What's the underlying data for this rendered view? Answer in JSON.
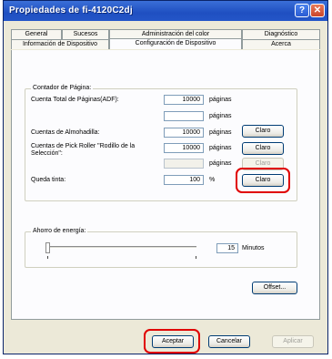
{
  "window": {
    "title": "Propiedades de fi-4120C2dj"
  },
  "tabs": {
    "row_back": [
      "General",
      "Sucesos",
      "Administración del color",
      "Diagnóstico"
    ],
    "row_front": [
      "Información de Dispositivo",
      "Configuración de Dispositivo",
      "Acerca"
    ],
    "active": "Configuración de Dispositivo"
  },
  "counter": {
    "group_label": "Contador de Página:",
    "rows": [
      {
        "label": "Cuenta Total de Páginas(ADF):",
        "value": "10000",
        "unit": "páginas",
        "button": ""
      },
      {
        "label": "",
        "value": "",
        "unit": "páginas",
        "button": ""
      },
      {
        "label": "Cuentas de Almohadilla:",
        "value": "10000",
        "unit": "páginas",
        "button": "Claro"
      },
      {
        "label": "Cuentas de Pick Roller \"Rodillo de la Selección\":",
        "value": "10000",
        "unit": "páginas",
        "button": "Claro"
      },
      {
        "label": "",
        "value": "",
        "unit": "páginas",
        "button": "Claro"
      },
      {
        "label": "Queda tinta:",
        "value": "100",
        "unit": "%",
        "button": "Claro"
      }
    ]
  },
  "energy": {
    "group_label": "Ahorro de energía:",
    "value": "15",
    "unit": "Minutos",
    "slider_fraction": 0.0
  },
  "buttons": {
    "offset": "Offset...",
    "accept": "Aceptar",
    "cancel": "Cancelar",
    "apply": "Aplicar"
  },
  "colors": {
    "highlight": "#e00000",
    "titlebar": "#245edb"
  }
}
